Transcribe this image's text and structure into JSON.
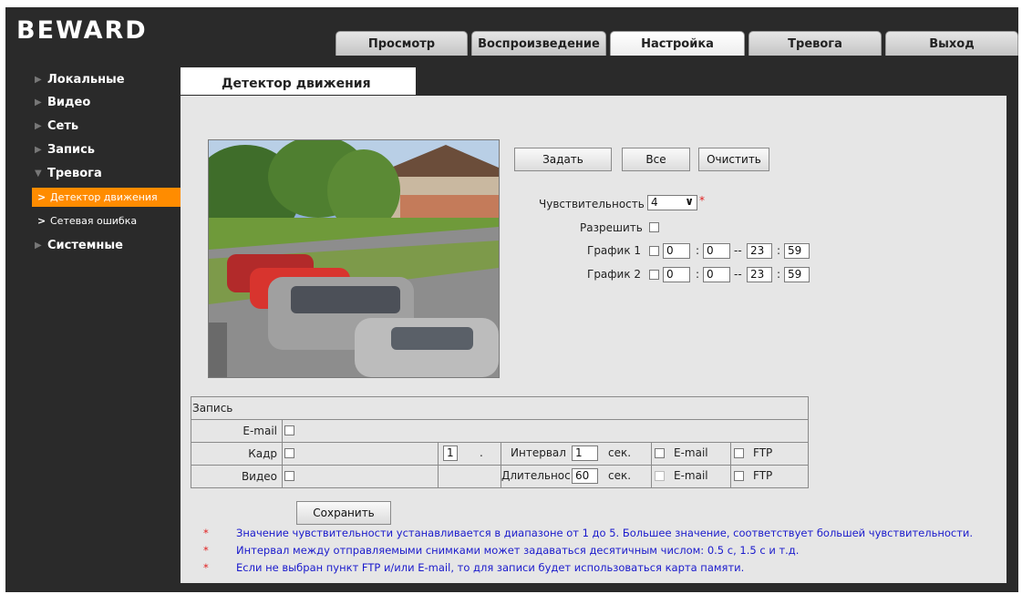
{
  "brand": {
    "logo": "BEWARD"
  },
  "tabs": [
    "Просмотр",
    "Воспроизведение",
    "Настройка",
    "Тревога",
    "Выход"
  ],
  "active_tab": "Настройка",
  "sidebar": {
    "items": [
      {
        "label": "Локальные"
      },
      {
        "label": "Видео"
      },
      {
        "label": "Сеть"
      },
      {
        "label": "Запись"
      },
      {
        "label": "Тревога"
      }
    ],
    "subitems": [
      {
        "label": "Детектор движения",
        "active": true
      },
      {
        "label": "Сетевая ошибка",
        "active": false
      }
    ],
    "last_item": "Системные"
  },
  "section": {
    "title": "Детектор движения"
  },
  "buttons": {
    "set": "Задать",
    "all": "Все",
    "clear": "Очистить",
    "save": "Сохранить"
  },
  "form": {
    "sensitivity_label": "Чувствительность",
    "sensitivity_value": "4",
    "enable_label": "Разрешить",
    "schedule1_label": "График 1",
    "schedule2_label": "График 2",
    "schedule1": {
      "start_h": "0",
      "start_m": "0",
      "end_h": "23",
      "end_m": "59"
    },
    "schedule2": {
      "start_h": "0",
      "start_m": "0",
      "end_h": "23",
      "end_m": "59"
    },
    "sep": ":",
    "dash": "--"
  },
  "record": {
    "header": "Запись",
    "email": "E-mail",
    "frame": "Кадр",
    "video": "Видео",
    "frame_count": "1",
    "dot": ".",
    "interval_label": "Интервал",
    "interval_value": "1",
    "duration_label": "Длительнос",
    "duration_value": "60",
    "sec": "сек.",
    "ftp": "FTP"
  },
  "notes": [
    "Значение чувствительности устанавливается в диапазоне от 1 до 5. Большее значение, соответствует большей чувствительности.",
    "Интервал между отправляемыми снимками может задаваться десятичным числом: 0.5 с, 1.5 с и т.д.",
    "Если не выбран пункт FTP и/или E-mail, то для записи будет использоваться карта памяти."
  ],
  "colors": {
    "active_nav": "#ff8c00",
    "note_text": "#1a1acc",
    "asterisk": "#e02020"
  }
}
